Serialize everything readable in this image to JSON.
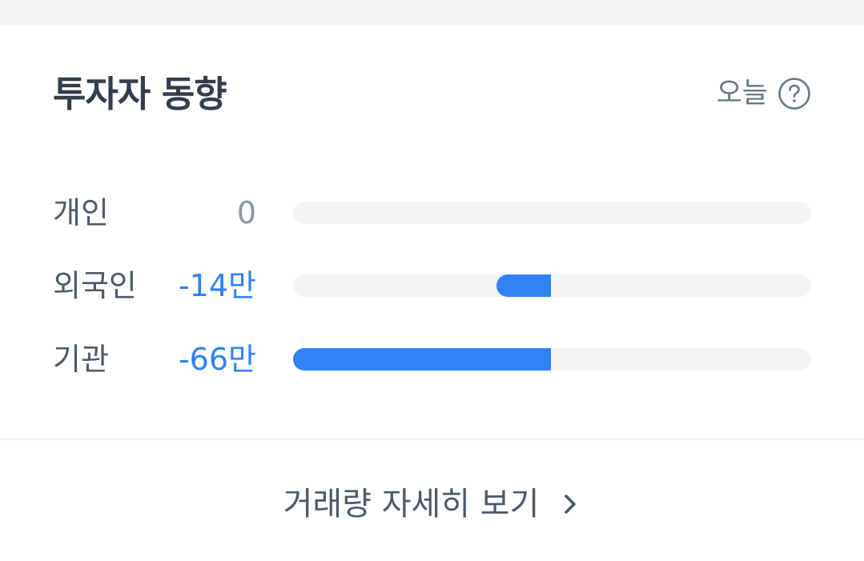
{
  "header": {
    "title": "투자자 동향",
    "period_label": "오늘",
    "help_icon": "question-circle-icon"
  },
  "investors": [
    {
      "label": "개인",
      "value": "0",
      "net_amount_man": 0
    },
    {
      "label": "외국인",
      "value": "-14만",
      "net_amount_man": -14
    },
    {
      "label": "기관",
      "value": "-66만",
      "net_amount_man": -66
    }
  ],
  "bar_scale_max_man": 66,
  "footer": {
    "more_label": "거래량 자세히 보기",
    "chevron_icon": "chevron-right-icon"
  },
  "colors": {
    "accent": "#3182f6",
    "track": "#f2f4f6",
    "title": "#333d4b",
    "label": "#4e5968",
    "muted": "#8b95a1",
    "page_background": "#f2f3f5"
  }
}
